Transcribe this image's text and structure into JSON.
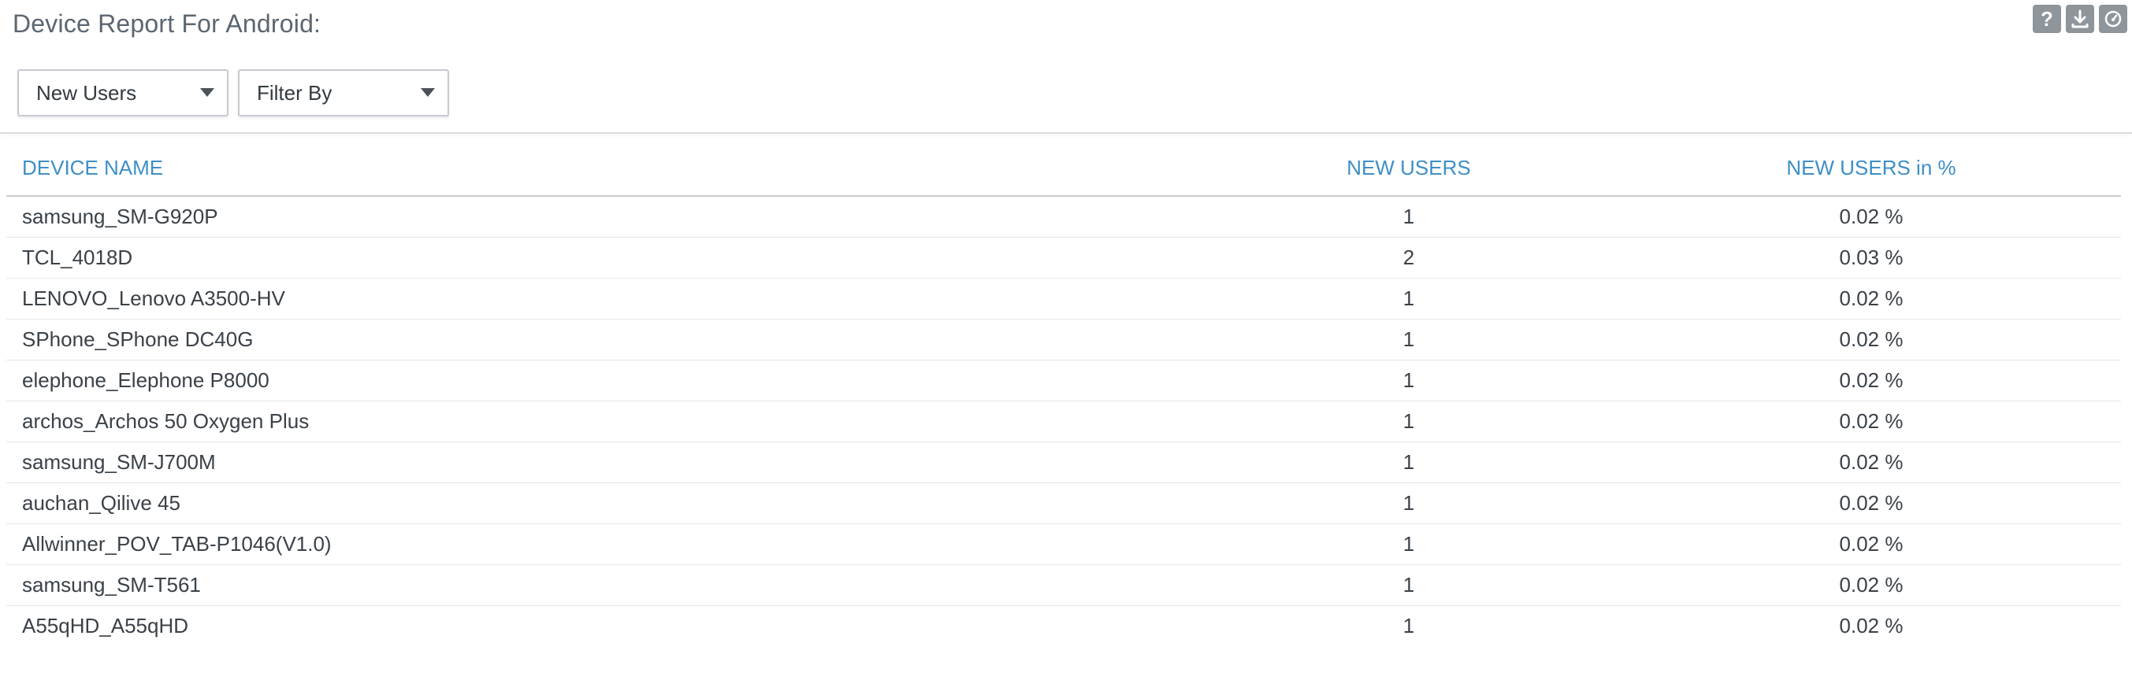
{
  "page": {
    "title": "Device Report For Android:"
  },
  "header_actions": [
    {
      "icon": "help-icon",
      "glyph": "?"
    },
    {
      "icon": "download-icon"
    },
    {
      "icon": "dashboard-icon"
    }
  ],
  "filters": {
    "metric_select": {
      "value": "New Users"
    },
    "filter_select": {
      "value": "Filter By"
    }
  },
  "table": {
    "columns": [
      "DEVICE NAME",
      "NEW USERS",
      "NEW USERS in %"
    ],
    "rows": [
      [
        "samsung_SM-G920P",
        "1",
        "0.02 %"
      ],
      [
        "TCL_4018D",
        "2",
        "0.03 %"
      ],
      [
        "LENOVO_Lenovo A3500-HV",
        "1",
        "0.02 %"
      ],
      [
        "SPhone_SPhone DC40G",
        "1",
        "0.02 %"
      ],
      [
        "elephone_Elephone P8000",
        "1",
        "0.02 %"
      ],
      [
        "archos_Archos 50 Oxygen Plus",
        "1",
        "0.02 %"
      ],
      [
        "samsung_SM-J700M",
        "1",
        "0.02 %"
      ],
      [
        "auchan_Qilive 45",
        "1",
        "0.02 %"
      ],
      [
        "Allwinner_POV_TAB-P1046(V1.0)",
        "1",
        "0.02 %"
      ],
      [
        "samsung_SM-T561",
        "1",
        "0.02 %"
      ],
      [
        "A55qHD_A55qHD",
        "1",
        "0.02 %"
      ]
    ]
  },
  "colors": {
    "header_link": "#3f8fc6",
    "title": "#5b6670",
    "action_button": "#8e959b"
  }
}
